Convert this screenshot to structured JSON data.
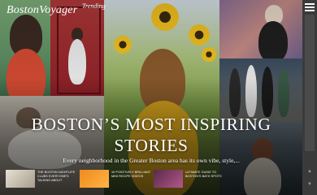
{
  "header": {
    "logo": "BostonVoyager",
    "section": "Trending"
  },
  "icons": {
    "menu": "hamburger-menu-icon"
  },
  "hero": {
    "headline_line1": "BOSTON’S MOST INSPIRING",
    "headline_line2": "STORIES",
    "subtitle": "Every neighborhood in the Greater Boston area has its own vibe, style,..."
  },
  "cards": [
    {
      "label": "THE BOSTON NIGHTLIFE CLUBS EVERYONE'S TALKING ABOUT"
    },
    {
      "label": "10 POSITIVELY BRILLIANT MINI RECIPE VIDEOS"
    },
    {
      "label": "ULTIMATE GUIDE TO BOSTON'S BATH SPOTS"
    }
  ],
  "colors": {
    "text": "#ffffff",
    "rail": "#3a3a3a"
  }
}
